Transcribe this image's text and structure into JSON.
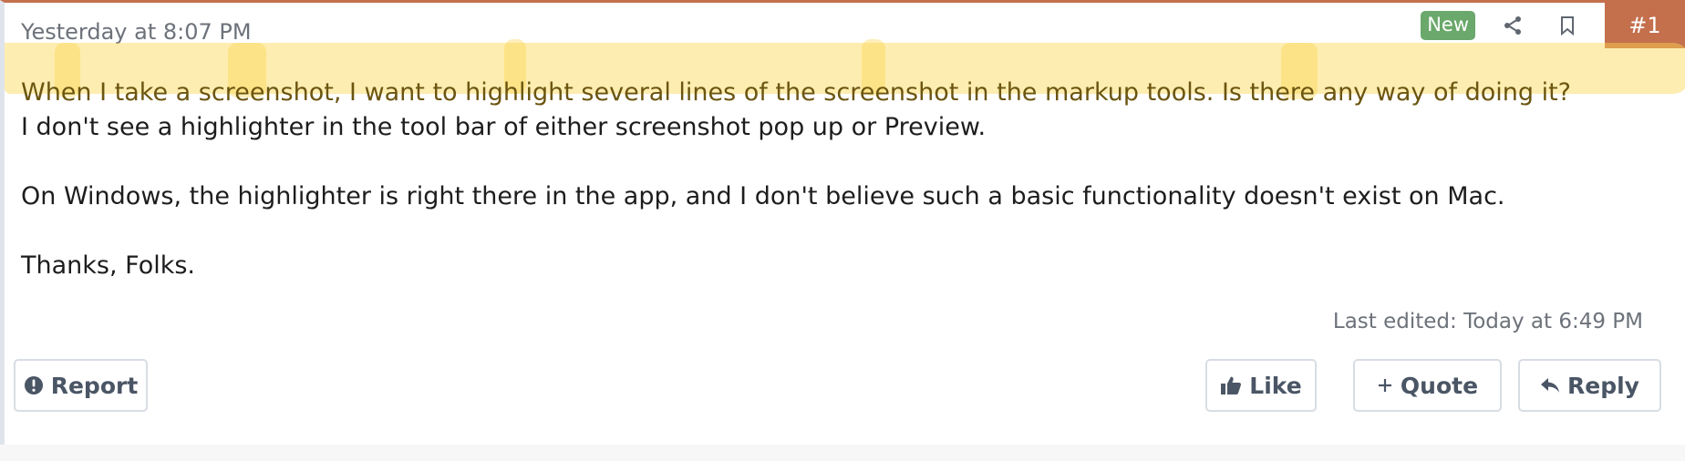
{
  "post": {
    "timestamp": "Yesterday at 8:07 PM",
    "badge": "New",
    "number": "#1",
    "lines": [
      "When I take a screenshot, I want to highlight several lines of the screenshot in the markup tools. Is there any way of doing it?",
      "I don't see a highlighter in the tool bar of either screenshot pop up or Preview.",
      "On Windows, the highlighter is right there in the app, and I don't believe such a basic functionality doesn't exist on Mac.",
      "Thanks, Folks."
    ],
    "edited": "Last edited: Today at 6:49 PM"
  },
  "actions": {
    "report": "Report",
    "like": "Like",
    "quote": "Quote",
    "reply": "Reply"
  },
  "icons": {
    "share": "share-icon",
    "bookmark": "bookmark-icon",
    "report": "exclamation-circle-icon",
    "like": "thumbs-up-icon",
    "quote": "plus-icon",
    "reply": "reply-arrow-icon"
  },
  "colors": {
    "accent": "#c4704d",
    "badge_new": "#6aa86b",
    "highlight": "#fcd650"
  }
}
